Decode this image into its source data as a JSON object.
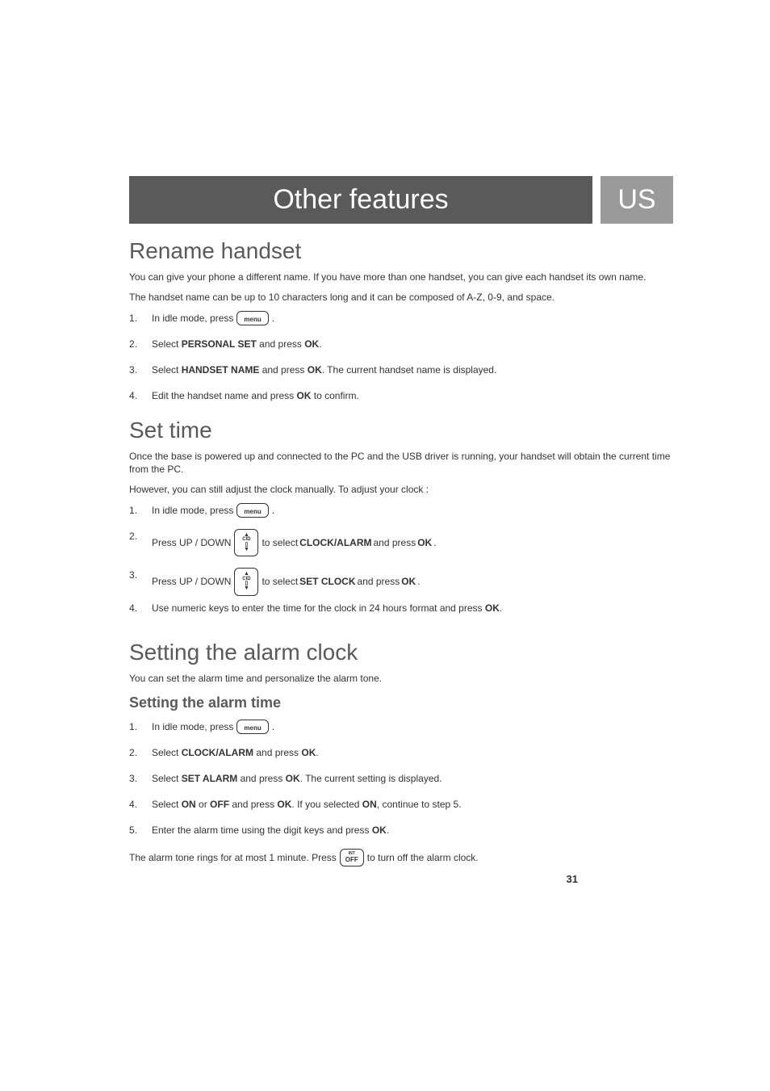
{
  "header": {
    "title": "Other features",
    "region": "US"
  },
  "sections": {
    "rename": {
      "heading": "Rename handset",
      "intro1": "You can give your phone a different name. If you have more than one handset, you can give each handset its own name.",
      "intro2": "The handset name can be up to 10 characters long and it can be composed of A-Z, 0-9, and space.",
      "steps": {
        "s1a": "In idle mode, press ",
        "s1b": ".",
        "s2a": "Select ",
        "s2b": "PERSONAL SET",
        "s2c": " and press ",
        "s2d": "OK",
        "s2e": ".",
        "s3a": "Select ",
        "s3b": "HANDSET NAME",
        "s3c": " and press ",
        "s3d": "OK",
        "s3e": ". The current handset name is displayed.",
        "s4a": "Edit the handset name and press ",
        "s4b": "OK",
        "s4c": " to confirm."
      }
    },
    "settime": {
      "heading": "Set time",
      "intro1": "Once the base is powered up and connected to the PC and the USB driver is running, your handset will obtain the current time from the PC.",
      "intro2": "However, you can still adjust the clock manually. To adjust your clock :",
      "steps": {
        "s1a": "In idle mode, press ",
        "s1b": ".",
        "s2a": "Press  UP / DOWN",
        "s2b": " to select ",
        "s2c": "CLOCK/ALARM",
        "s2d": " and press ",
        "s2e": "OK",
        "s2f": ".",
        "s3a": "Press  UP / DOWN",
        "s3b": " to select ",
        "s3c": "SET CLOCK",
        "s3d": " and press ",
        "s3e": "OK",
        "s3f": ".",
        "s4a": "Use numeric keys to enter the time for the clock in 24 hours format and press ",
        "s4b": "OK",
        "s4c": "."
      }
    },
    "alarm": {
      "heading": "Setting the alarm clock",
      "intro1": "You can set the alarm time and personalize the alarm tone.",
      "subheading": "Setting the alarm time",
      "steps": {
        "s1a": "In idle mode, press ",
        "s1b": ".",
        "s2a": "Select ",
        "s2b": "CLOCK/ALARM",
        "s2c": " and press ",
        "s2d": "OK",
        "s2e": ".",
        "s3a": "Select ",
        "s3b": "SET ALARM",
        "s3c": " and press ",
        "s3d": "OK",
        "s3e": ". The current setting is displayed.",
        "s4a": "Select ",
        "s4b": "ON",
        "s4c": " or ",
        "s4d": "OFF",
        "s4e": " and press ",
        "s4f": "OK",
        "s4g": ".  If you selected ",
        "s4h": "ON",
        "s4i": ", continue to step 5.",
        "s5a": "Enter the alarm time using the digit keys and press ",
        "s5b": "OK",
        "s5c": "."
      },
      "footer_a": "The alarm tone rings for at most 1 minute. Press ",
      "footer_b": " to turn off the alarm clock."
    }
  },
  "icons": {
    "menu": "menu",
    "cid": "CID",
    "off_top": "INT",
    "off_main": "OFF"
  },
  "page_number": "31"
}
